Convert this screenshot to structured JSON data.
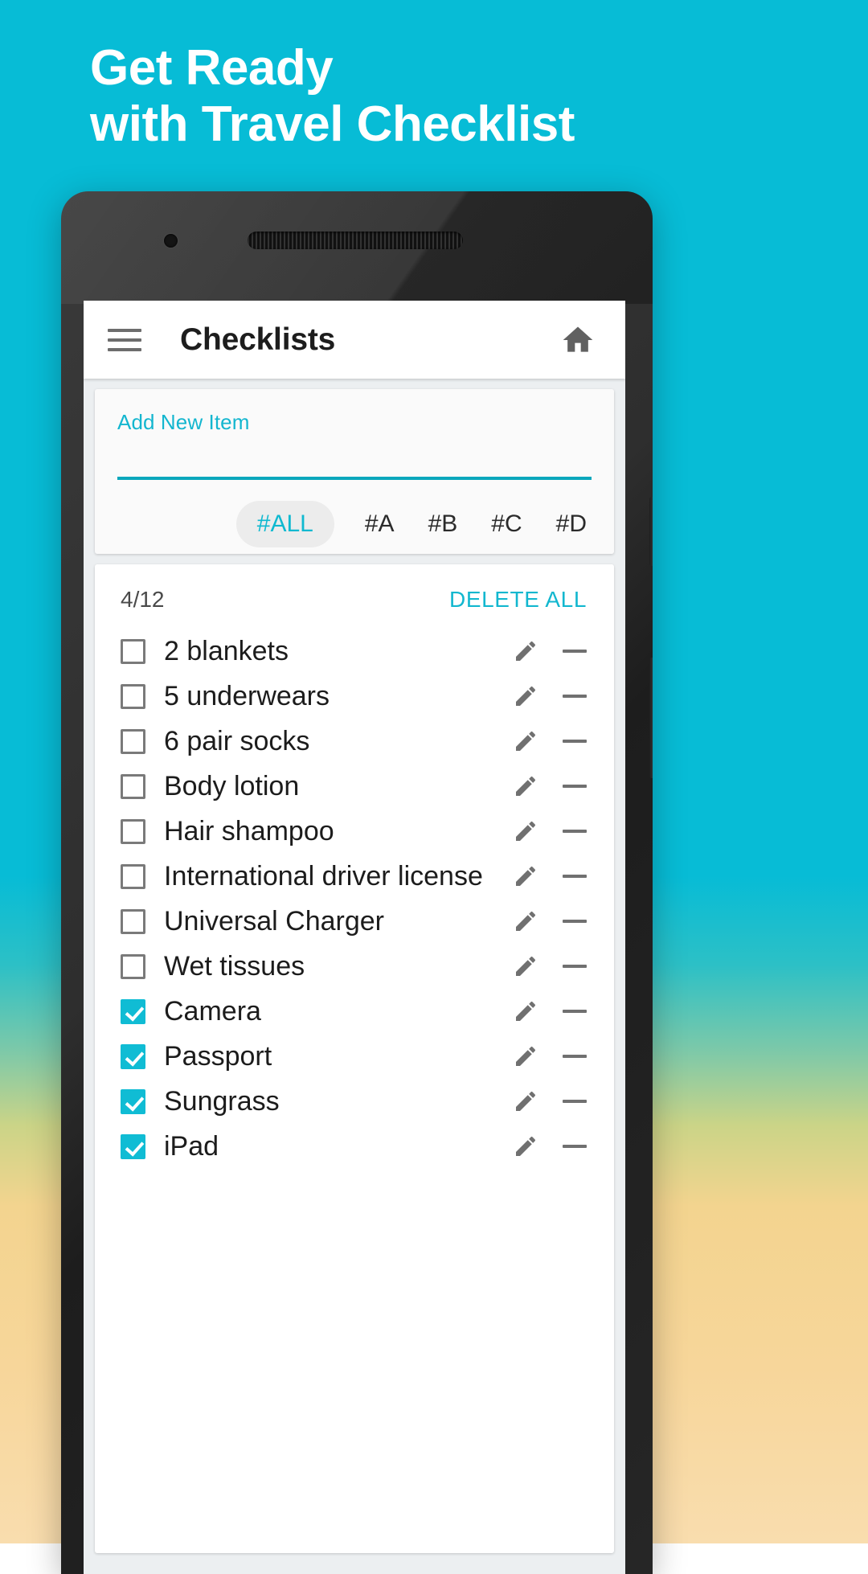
{
  "promo": {
    "headline_line1": "Get Ready",
    "headline_line2": "with Travel Checklist",
    "background_top_color": "#07BCD6",
    "background_bottom_color": "#F9DDAE",
    "text_color": "#FFFFFF"
  },
  "app": {
    "accent_color": "#10BCD4",
    "appbar": {
      "menu_icon": "hamburger-menu-icon",
      "title": "Checklists",
      "home_icon": "home-icon"
    },
    "add_card": {
      "label": "Add New Item",
      "input_value": "",
      "input_placeholder": ""
    },
    "filters": [
      {
        "label": "#ALL",
        "active": true
      },
      {
        "label": "#A",
        "active": false
      },
      {
        "label": "#B",
        "active": false
      },
      {
        "label": "#C",
        "active": false
      },
      {
        "label": "#D",
        "active": false
      }
    ],
    "list_header": {
      "count": "4/12",
      "delete_all_label": "DELETE ALL"
    },
    "items": [
      {
        "label": "2 blankets",
        "checked": false
      },
      {
        "label": "5 underwears",
        "checked": false
      },
      {
        "label": "6 pair socks",
        "checked": false
      },
      {
        "label": "Body lotion",
        "checked": false
      },
      {
        "label": "Hair shampoo",
        "checked": false
      },
      {
        "label": "International driver license",
        "checked": false
      },
      {
        "label": "Universal Charger",
        "checked": false
      },
      {
        "label": "Wet tissues",
        "checked": false
      },
      {
        "label": "Camera",
        "checked": true
      },
      {
        "label": "Passport",
        "checked": true
      },
      {
        "label": "Sungrass",
        "checked": true
      },
      {
        "label": "iPad",
        "checked": true
      }
    ],
    "row_icons": {
      "edit": "pencil-edit-icon",
      "delete": "minus-remove-icon"
    }
  }
}
